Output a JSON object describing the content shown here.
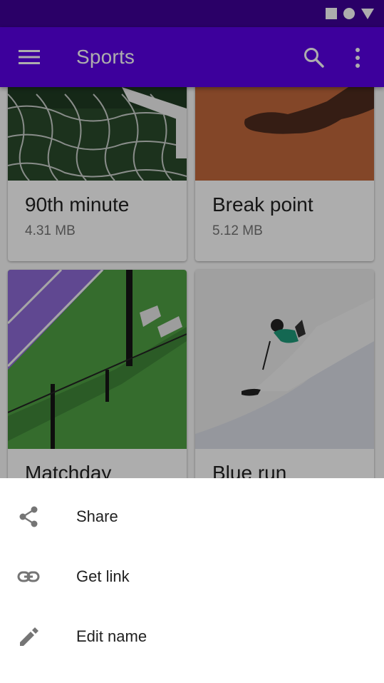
{
  "status_bar": {
    "icons": [
      "square-icon",
      "circle-icon",
      "triangle-icon"
    ]
  },
  "app_bar": {
    "title": "Sports",
    "nav_icon": "menu-icon",
    "actions": [
      "search-icon",
      "more-vert-icon"
    ],
    "color": "#5a00e6"
  },
  "cards": [
    {
      "title": "90th minute",
      "size": "4.31 MB",
      "image": "soccer-goal-net"
    },
    {
      "title": "Break point",
      "size": "5.12 MB",
      "image": "clay-court-shadow"
    },
    {
      "title": "Matchday",
      "size": "",
      "image": "tennis-court-fence"
    },
    {
      "title": "Blue run",
      "size": "",
      "image": "skier-on-slope"
    }
  ],
  "bottom_sheet": {
    "items": [
      {
        "label": "Share",
        "icon": "share-icon"
      },
      {
        "label": "Get link",
        "icon": "link-icon"
      },
      {
        "label": "Edit name",
        "icon": "edit-icon"
      }
    ]
  }
}
